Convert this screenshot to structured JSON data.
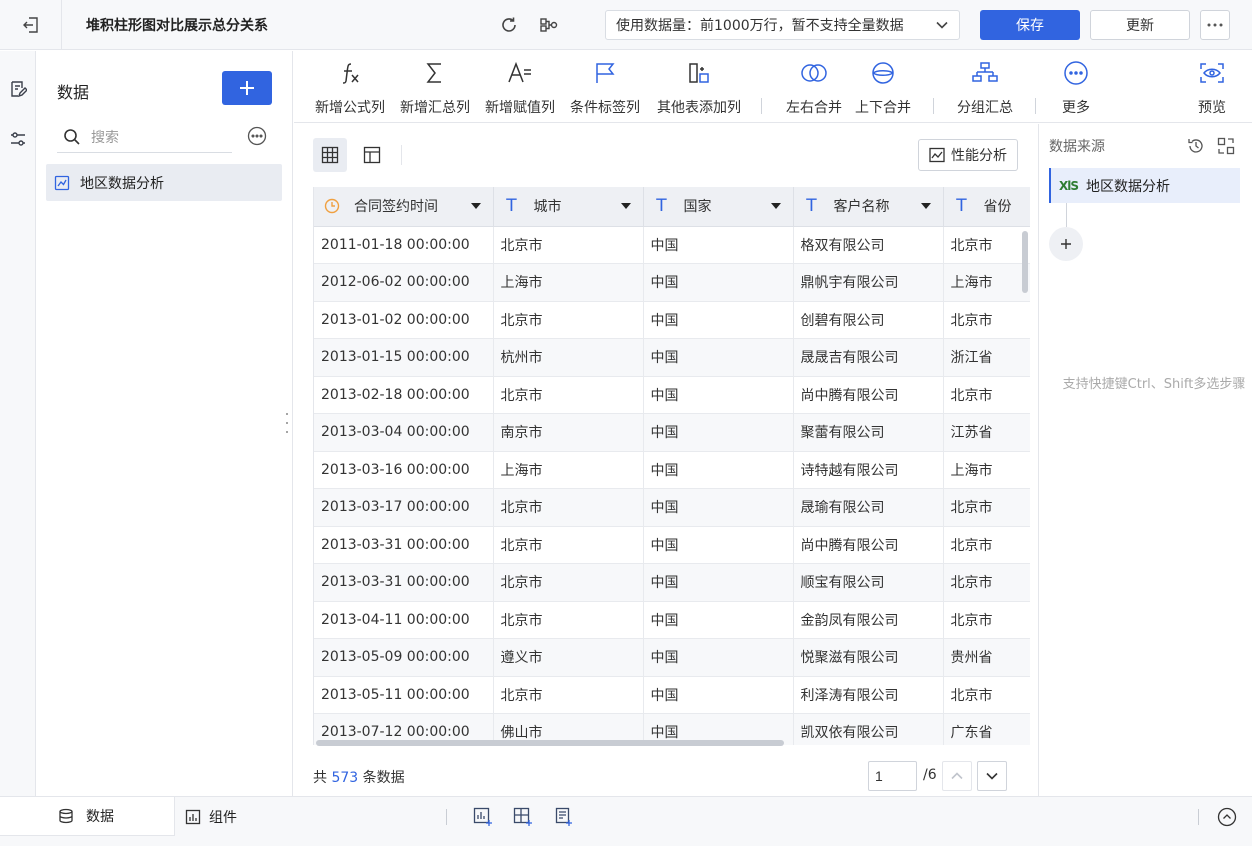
{
  "header": {
    "title": "堆积柱形图对比展示总分关系",
    "data_limit": "使用数据量：前1000万行，暂不支持全量数据",
    "save_label": "保存",
    "update_label": "更新"
  },
  "sidebar": {
    "title": "数据",
    "search_placeholder": "搜索",
    "table_name": "地区数据分析"
  },
  "toolbar": {
    "items": [
      {
        "label": "新增公式列",
        "icon": "formula-icon"
      },
      {
        "label": "新增汇总列",
        "icon": "sigma-icon"
      },
      {
        "label": "新增赋值列",
        "icon": "assign-icon"
      },
      {
        "label": "条件标签列",
        "icon": "flag-icon"
      },
      {
        "label": "其他表添加列",
        "icon": "add-column-icon"
      },
      {
        "label": "左右合并",
        "icon": "merge-horizontal-icon"
      },
      {
        "label": "上下合并",
        "icon": "merge-vertical-icon"
      },
      {
        "label": "分组汇总",
        "icon": "group-icon"
      },
      {
        "label": "更多",
        "icon": "more-icon"
      },
      {
        "label": "预览",
        "icon": "preview-icon"
      }
    ]
  },
  "main": {
    "perf_label": "性能分析",
    "columns": [
      {
        "name": "合同签约时间",
        "type": "date"
      },
      {
        "name": "城市",
        "type": "text"
      },
      {
        "name": "国家",
        "type": "text"
      },
      {
        "name": "客户名称",
        "type": "text"
      },
      {
        "name": "省份",
        "type": "text"
      }
    ],
    "rows": [
      [
        "2011-01-18 00:00:00",
        "北京市",
        "中国",
        "格双有限公司",
        "北京市"
      ],
      [
        "2012-06-02 00:00:00",
        "上海市",
        "中国",
        "鼎帆宇有限公司",
        "上海市"
      ],
      [
        "2013-01-02 00:00:00",
        "北京市",
        "中国",
        "创碧有限公司",
        "北京市"
      ],
      [
        "2013-01-15 00:00:00",
        "杭州市",
        "中国",
        "晟晟吉有限公司",
        "浙江省"
      ],
      [
        "2013-02-18 00:00:00",
        "北京市",
        "中国",
        "尚中腾有限公司",
        "北京市"
      ],
      [
        "2013-03-04 00:00:00",
        "南京市",
        "中国",
        "聚蕾有限公司",
        "江苏省"
      ],
      [
        "2013-03-16 00:00:00",
        "上海市",
        "中国",
        "诗特越有限公司",
        "上海市"
      ],
      [
        "2013-03-17 00:00:00",
        "北京市",
        "中国",
        "晟瑜有限公司",
        "北京市"
      ],
      [
        "2013-03-31 00:00:00",
        "北京市",
        "中国",
        "尚中腾有限公司",
        "北京市"
      ],
      [
        "2013-03-31 00:00:00",
        "北京市",
        "中国",
        "顺宝有限公司",
        "北京市"
      ],
      [
        "2013-04-11 00:00:00",
        "北京市",
        "中国",
        "金韵凤有限公司",
        "北京市"
      ],
      [
        "2013-05-09 00:00:00",
        "遵义市",
        "中国",
        "悦聚滋有限公司",
        "贵州省"
      ],
      [
        "2013-05-11 00:00:00",
        "北京市",
        "中国",
        "利泽涛有限公司",
        "北京市"
      ],
      [
        "2013-07-12 00:00:00",
        "佛山市",
        "中国",
        "凯双依有限公司",
        "广东省"
      ]
    ],
    "count_prefix": "共",
    "count_value": "573",
    "count_suffix": "条数据",
    "page_value": "1",
    "page_total": "/6"
  },
  "right_panel": {
    "title": "数据来源",
    "source_badge": "XlS",
    "source_name": "地区数据分析",
    "add_label": "+",
    "hint": "支持快捷键Ctrl、Shift多选步骤"
  },
  "bottom": {
    "tab_data": "数据",
    "tab_component": "组件"
  },
  "colors": {
    "accent": "#3164e0",
    "date_icon": "#f0a040",
    "excel_green": "#2e7d32"
  }
}
